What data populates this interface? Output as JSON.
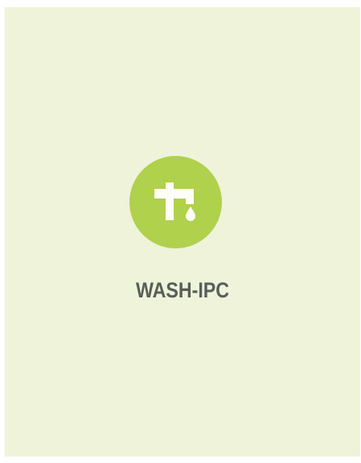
{
  "tile": {
    "label": "WASH-IPC",
    "icon": "water-tap-icon",
    "background_color": "#eef3da",
    "icon_color": "#b0d14c",
    "text_color": "#5a5d58"
  }
}
